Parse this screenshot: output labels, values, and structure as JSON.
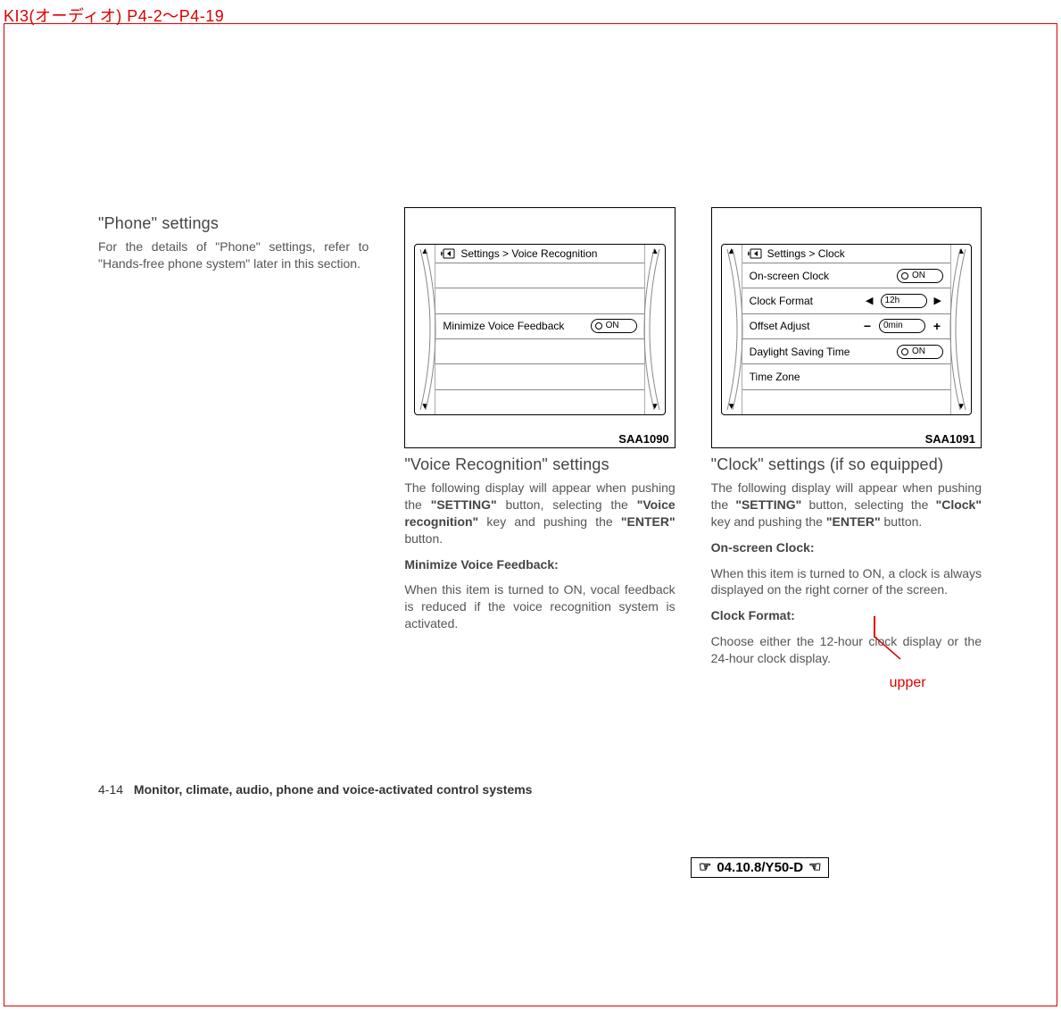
{
  "header_annotation": "KI3(オーディオ) P4-2～P4-19",
  "col1": {
    "title": "\"Phone\" settings",
    "body": "For the details of \"Phone\" settings, refer to \"Hands-free phone system\" later in this section."
  },
  "col2": {
    "figure": {
      "code": "SAA1090",
      "breadcrumb": "Settings > Voice Recognition",
      "rows": [
        {
          "label": "",
          "value": ""
        },
        {
          "label": "",
          "value": ""
        },
        {
          "label": "Minimize Voice Feedback",
          "value": "ON",
          "type": "toggle"
        },
        {
          "label": "",
          "value": ""
        },
        {
          "label": "",
          "value": ""
        },
        {
          "label": "",
          "value": ""
        }
      ]
    },
    "title": "\"Voice Recognition\" settings",
    "p1_a": "The following display will appear when pushing the ",
    "p1_b": "\"SETTING\"",
    "p1_c": " button, selecting the ",
    "p1_d": "\"Voice recognition\"",
    "p1_e": " key and pushing the ",
    "p1_f": "\"ENTER\"",
    "p1_g": " button.",
    "sub1": "Minimize Voice Feedback:",
    "p2": "When this item is turned to ON, vocal feedback is reduced if the voice recognition system is activated."
  },
  "col3": {
    "figure": {
      "code": "SAA1091",
      "breadcrumb": "Settings > Clock",
      "rows": [
        {
          "label": "On-screen Clock",
          "value": "ON",
          "type": "toggle"
        },
        {
          "label": "Clock Format",
          "value": "12h",
          "type": "selector"
        },
        {
          "label": "Offset Adjust",
          "value": "0min",
          "type": "spinner"
        },
        {
          "label": "Daylight Saving Time",
          "value": "ON",
          "type": "toggle"
        },
        {
          "label": "Time Zone",
          "value": "",
          "type": "nav"
        },
        {
          "label": "",
          "value": ""
        }
      ]
    },
    "title": "\"Clock\" settings (if so equipped)",
    "p1_a": "The following display will appear when pushing the ",
    "p1_b": "\"SETTING\"",
    "p1_c": " button, selecting the ",
    "p1_d": "\"Clock\"",
    "p1_e": " key and pushing the ",
    "p1_f": "\"ENTER\"",
    "p1_g": " button.",
    "sub1": "On-screen Clock:",
    "p2": "When this item is turned to ON, a clock is always displayed on the right corner of the screen.",
    "sub2": "Clock Format:",
    "p3": "Choose either the 12-hour clock display or the 24-hour clock display."
  },
  "footer": {
    "page_num": "4-14",
    "section": "Monitor, climate, audio, phone and voice-activated control systems"
  },
  "revision_stamp": "04.10.8/Y50-D",
  "annotation": "upper"
}
